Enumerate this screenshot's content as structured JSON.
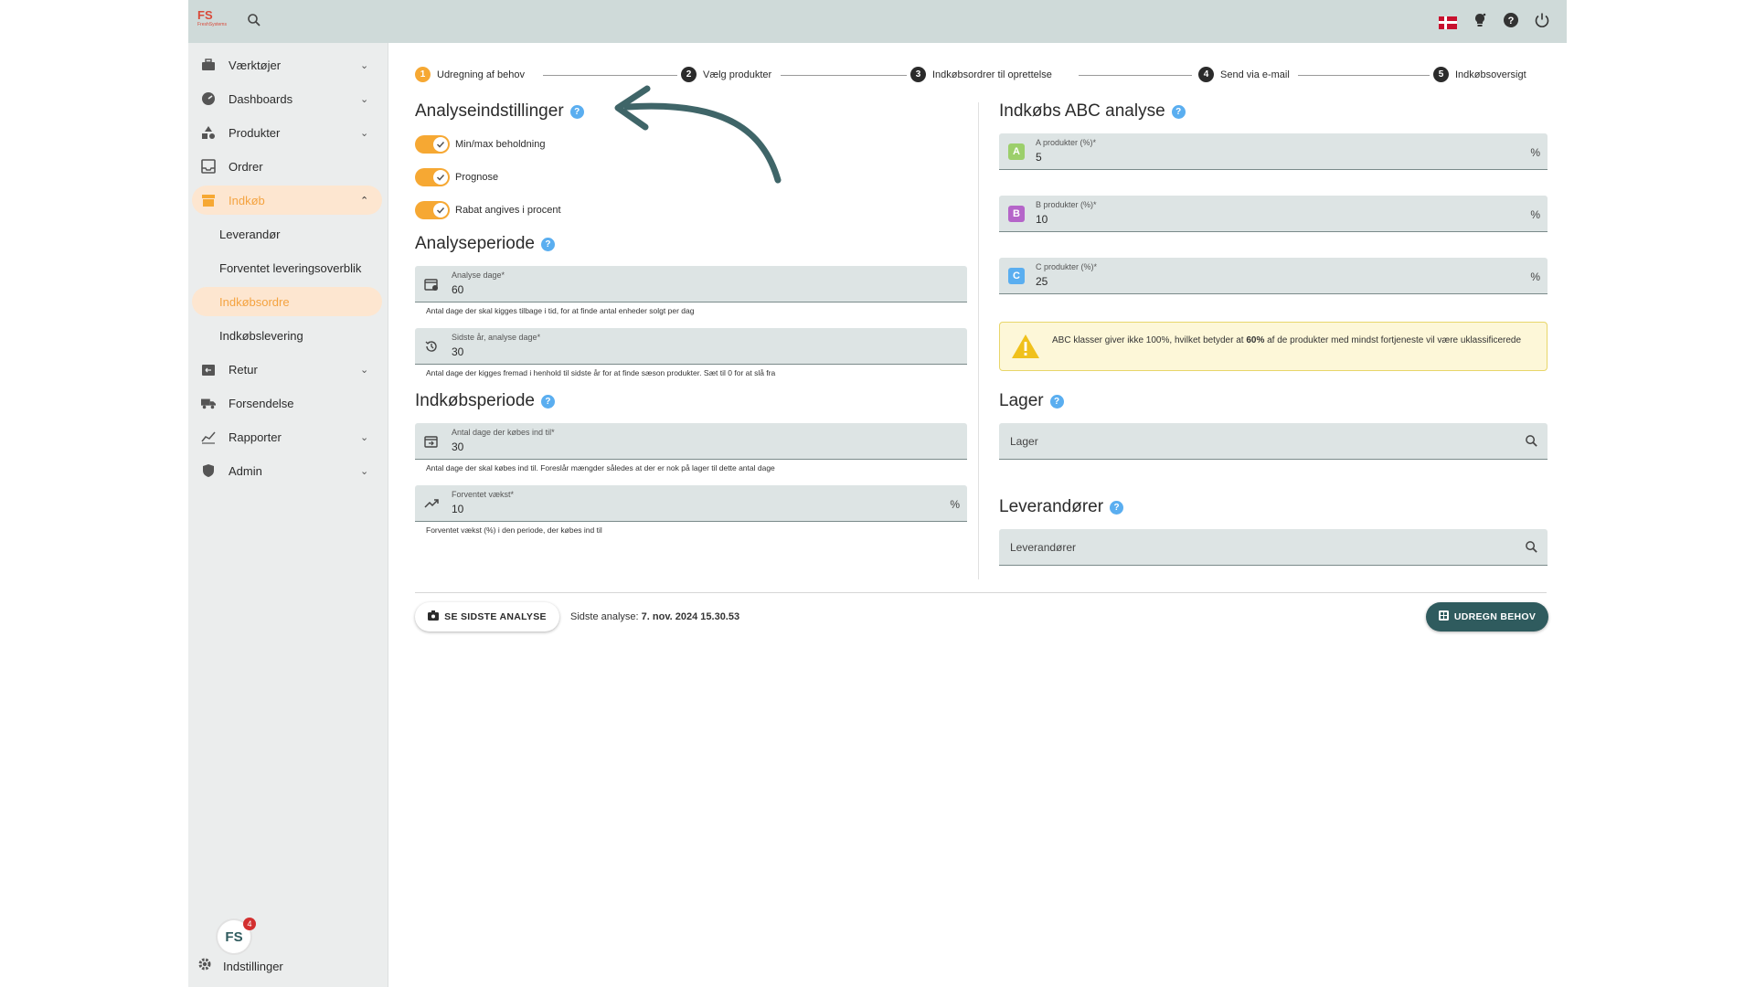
{
  "header": {
    "logo_text": "FS",
    "logo_sub": "FreshSystems",
    "notification_count": "4"
  },
  "sidebar": {
    "items": [
      {
        "label": "Værktøjer",
        "icon": "toolbox-icon"
      },
      {
        "label": "Dashboards",
        "icon": "speedometer-icon"
      },
      {
        "label": "Produkter",
        "icon": "shapes-icon"
      },
      {
        "label": "Ordrer",
        "icon": "inbox-icon"
      },
      {
        "label": "Indkøb",
        "icon": "store-icon"
      },
      {
        "label": "Retur",
        "icon": "return-box-icon"
      },
      {
        "label": "Forsendelse",
        "icon": "truck-icon"
      },
      {
        "label": "Rapporter",
        "icon": "chart-icon"
      },
      {
        "label": "Admin",
        "icon": "admin-icon"
      }
    ],
    "sub_items": [
      "Leverandør",
      "Forventet leveringsoverblik",
      "Indkøbsordre",
      "Indkøbslevering"
    ],
    "settings_label": "Indstillinger",
    "badge_count": "4"
  },
  "stepper": {
    "steps": [
      {
        "num": "1",
        "label": "Udregning af behov"
      },
      {
        "num": "2",
        "label": "Vælg produkter"
      },
      {
        "num": "3",
        "label": "Indkøbsordrer til oprettelse"
      },
      {
        "num": "4",
        "label": "Send via e-mail"
      },
      {
        "num": "5",
        "label": "Indkøbsoversigt"
      }
    ]
  },
  "left": {
    "analysis_settings_title": "Analyseindstillinger",
    "toggles": [
      "Min/max beholdning",
      "Prognose",
      "Rabat angives i procent"
    ],
    "analysis_period_title": "Analyseperiode",
    "analysis_days": {
      "label": "Analyse dage*",
      "value": "60",
      "hint": "Antal dage der skal kigges tilbage i tid, for at finde antal enheder solgt per dag"
    },
    "last_year_days": {
      "label": "Sidste år, analyse dage*",
      "value": "30",
      "hint": "Antal dage der kigges fremad i henhold til sidste år for at finde sæson produkter. Sæt til 0 for at slå fra"
    },
    "purchase_period_title": "Indkøbsperiode",
    "purchase_days": {
      "label": "Antal dage der købes ind til*",
      "value": "30",
      "hint": "Antal dage der skal købes ind til. Foreslår mængder således at der er nok på lager til dette antal dage"
    },
    "growth": {
      "label": "Forventet vækst*",
      "value": "10",
      "suffix": "%",
      "hint": "Forventet vækst (%) i den periode, der købes ind til"
    }
  },
  "right": {
    "abc_title": "Indkøbs ABC analyse",
    "abc_fields": [
      {
        "letter": "A",
        "label": "A produkter (%)*",
        "value": "5",
        "suffix": "%",
        "color": "#9ccf6b"
      },
      {
        "letter": "B",
        "label": "B produkter (%)*",
        "value": "10",
        "suffix": "%",
        "color": "#b565c9"
      },
      {
        "letter": "C",
        "label": "C produkter (%)*",
        "value": "25",
        "suffix": "%",
        "color": "#5aaef0"
      }
    ],
    "warning_pre": "ABC klasser giver ikke 100%, hvilket betyder at ",
    "warning_bold": "60%",
    "warning_post": " af de produkter med mindst fortjeneste vil være uklassificerede",
    "stock_title": "Lager",
    "stock_placeholder": "Lager",
    "suppliers_title": "Leverandører",
    "suppliers_placeholder": "Leverandører"
  },
  "footer": {
    "see_last_label": "SE SIDSTE ANALYSE",
    "last_analysis_label": "Sidste analyse:",
    "last_analysis_value": "7. nov. 2024 15.30.53",
    "calculate_label": "UDREGN BEHOV"
  },
  "colors": {
    "accent": "#f6a833",
    "primary": "#2f5b5e",
    "info": "#5aaef0"
  }
}
